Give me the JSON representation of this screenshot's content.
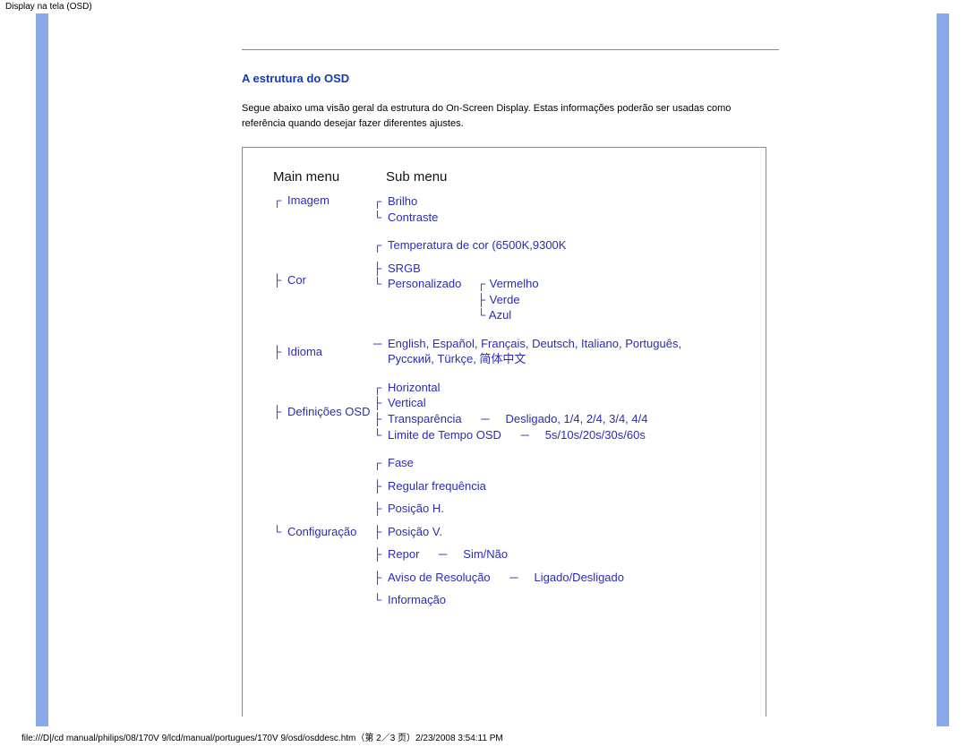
{
  "header_text": "Display na tela (OSD)",
  "section_heading": "A estrutura do OSD",
  "intro_text": "Segue abaixo uma visão geral da estrutura do On-Screen Display. Estas informações poderão ser usadas como referência quando desejar fazer diferentes ajustes.",
  "col_main": "Main menu",
  "col_sub": "Sub menu",
  "menu": {
    "imagem": {
      "label": "Imagem",
      "sub": {
        "brilho": "Brilho",
        "contraste": "Contraste"
      }
    },
    "cor": {
      "label": "Cor",
      "sub": {
        "temp": "Temperatura de cor (6500K,9300K",
        "srgb": "SRGB",
        "pers": "Personalizado",
        "pers_vals": {
          "r": "Vermelho",
          "g": "Verde",
          "b": "Azul"
        }
      }
    },
    "idioma": {
      "label": "Idioma",
      "line1": "English, Español, Français, Deutsch, Italiano, Português,",
      "line2": "Русский, Türkçe, 简体中文"
    },
    "osd": {
      "label": "Definições OSD",
      "sub": {
        "h": "Horizontal",
        "v": "Vertical",
        "trans": "Transparência",
        "trans_val": "Desligado, 1/4, 2/4, 3/4, 4/4",
        "tempo": "Limite de Tempo OSD",
        "tempo_val": "5s/10s/20s/30s/60s"
      }
    },
    "config": {
      "label": "Configuração",
      "sub": {
        "fase": "Fase",
        "freq": "Regular frequência",
        "ph": "Posição H.",
        "pv": "Posição V.",
        "repor": "Repor",
        "repor_val": "Sim/Não",
        "aviso": "Aviso de Resolução",
        "aviso_val": "Ligado/Desligado",
        "info": "Informação"
      }
    }
  },
  "footer_text": "file:///D|/cd manual/philips/08/170V 9/lcd/manual/portugues/170V 9/osd/osddesc.htm（第 2／3 页）2/23/2008 3:54:11 PM"
}
